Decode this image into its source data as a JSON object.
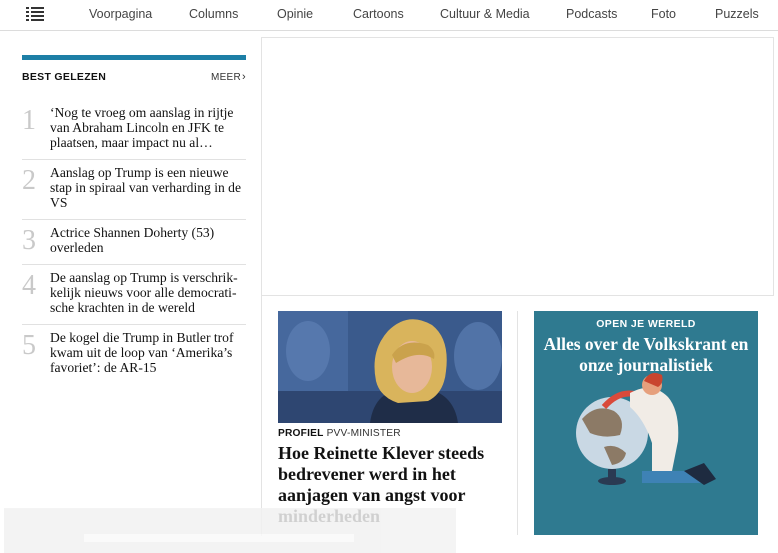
{
  "nav": {
    "items": [
      "Voorpagina",
      "Columns",
      "Opinie",
      "Cartoons",
      "Cultuur & Media",
      "Podcasts",
      "Foto",
      "Puzzels"
    ]
  },
  "best_read": {
    "title": "BEST GELEZEN",
    "more_label": "MEER",
    "items": [
      {
        "num": "1",
        "text": "‘Nog te vroeg om aanslag in rijtje van Abraham Lincoln en JFK te plaatsen, maar impact nu al…"
      },
      {
        "num": "2",
        "text": "Aanslag op Trump is een nieuwe stap in spiraal van verharding in de VS"
      },
      {
        "num": "3",
        "text": "Actrice Shannen Doherty (53) overleden"
      },
      {
        "num": "4",
        "text": "De aanslag op Trump is verschrik-kelijk nieuws voor alle democrati-sche krachten in de wereld"
      },
      {
        "num": "5",
        "text": "De kogel die Trump in Butler trof kwam uit de loop van ‘Amerika’s favoriet’: de AR-15"
      }
    ]
  },
  "article": {
    "kicker_label": "PROFIEL",
    "kicker_tag": "PVV-MINISTER",
    "title": "Hoe Reinette Klever steeds bedrevener werd in het aanjagen van angst voor minderheden"
  },
  "promo": {
    "kicker": "OPEN JE WERELD",
    "title": "Alles over de Volkskrant en onze journalistiek"
  },
  "colors": {
    "accent_bar": "#1d7fa6",
    "promo_bg": "#2f7a90"
  }
}
